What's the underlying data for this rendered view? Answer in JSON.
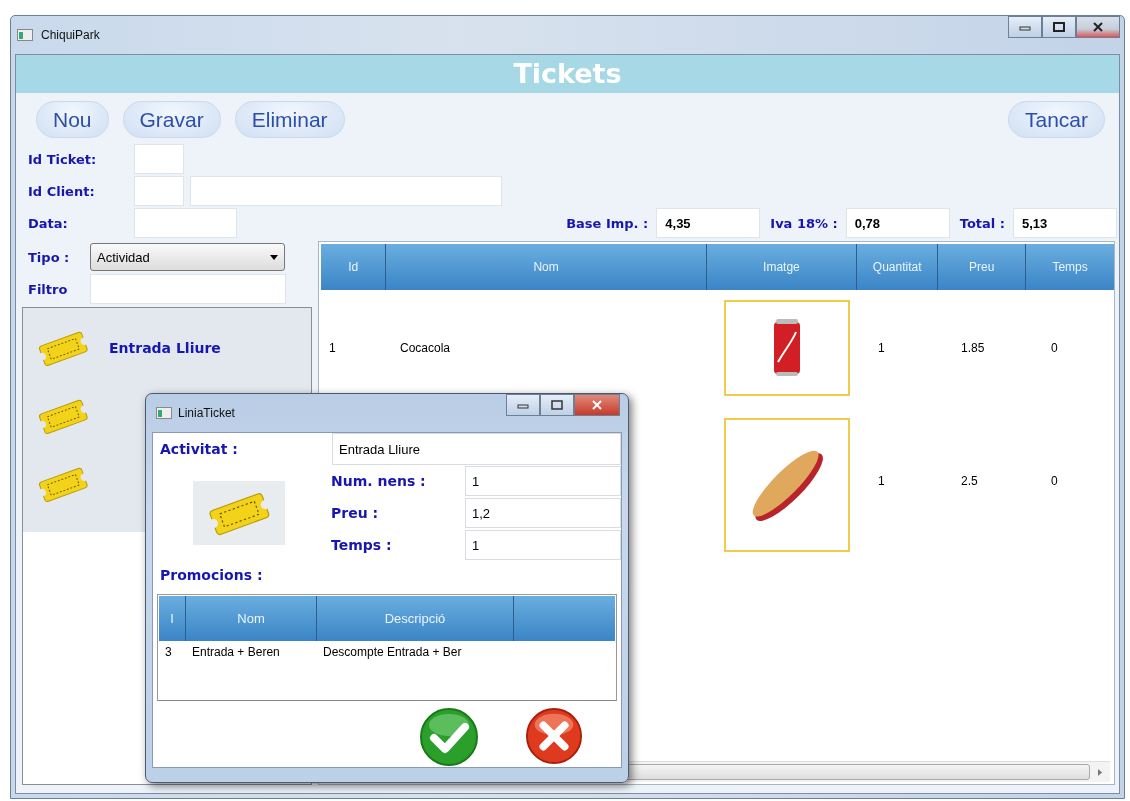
{
  "window": {
    "title": "ChiquiPark"
  },
  "header": {
    "title": "Tickets"
  },
  "toolbar": {
    "left": [
      "Nou",
      "Gravar",
      "Eliminar"
    ],
    "right": [
      "Tancar"
    ]
  },
  "form": {
    "id_ticket": {
      "label": "Id  Ticket:"
    },
    "id_client": {
      "label": "Id  Client:"
    },
    "data": {
      "label": "Data:"
    }
  },
  "totals": [
    {
      "label": "Base Imp. :",
      "value": "4,35"
    },
    {
      "label": "Iva 18% :",
      "value": "0,78"
    },
    {
      "label": "Total :",
      "value": "5,13"
    }
  ],
  "type_select": {
    "label": "Tipo :",
    "value": "Actividad"
  },
  "filter": {
    "label": "Filtro"
  },
  "activities": [
    {
      "kind": "named",
      "label": "Entrada Lliure"
    },
    {
      "kind": "icon"
    },
    {
      "kind": "icon"
    }
  ],
  "grid": {
    "columns": [
      "Id",
      "Nom",
      "Imatge",
      "Quantitat",
      "Preu",
      "Temps"
    ],
    "rows": [
      {
        "id": "1",
        "nom": "Cocacola",
        "quantitat": "1",
        "preu": "1.85",
        "temps": "0"
      },
      {
        "quantitat": "1",
        "preu": "2.5",
        "temps": "0"
      }
    ]
  },
  "dialog": {
    "title": "LiniaTicket",
    "activitat": {
      "label": "Activitat :",
      "value": "Entrada Lliure"
    },
    "fields": [
      {
        "label": "Num. nens :",
        "value": "1"
      },
      {
        "label": "Preu :",
        "value": "1,2"
      },
      {
        "label": "Temps :",
        "value": "1"
      }
    ],
    "promos_label": "Promocions :",
    "promos": {
      "columns": [
        "I",
        "Nom",
        "Descripció"
      ],
      "rows": [
        [
          "3",
          "Entrada + Beren",
          "Descompte Entrada + Ber"
        ]
      ]
    }
  }
}
